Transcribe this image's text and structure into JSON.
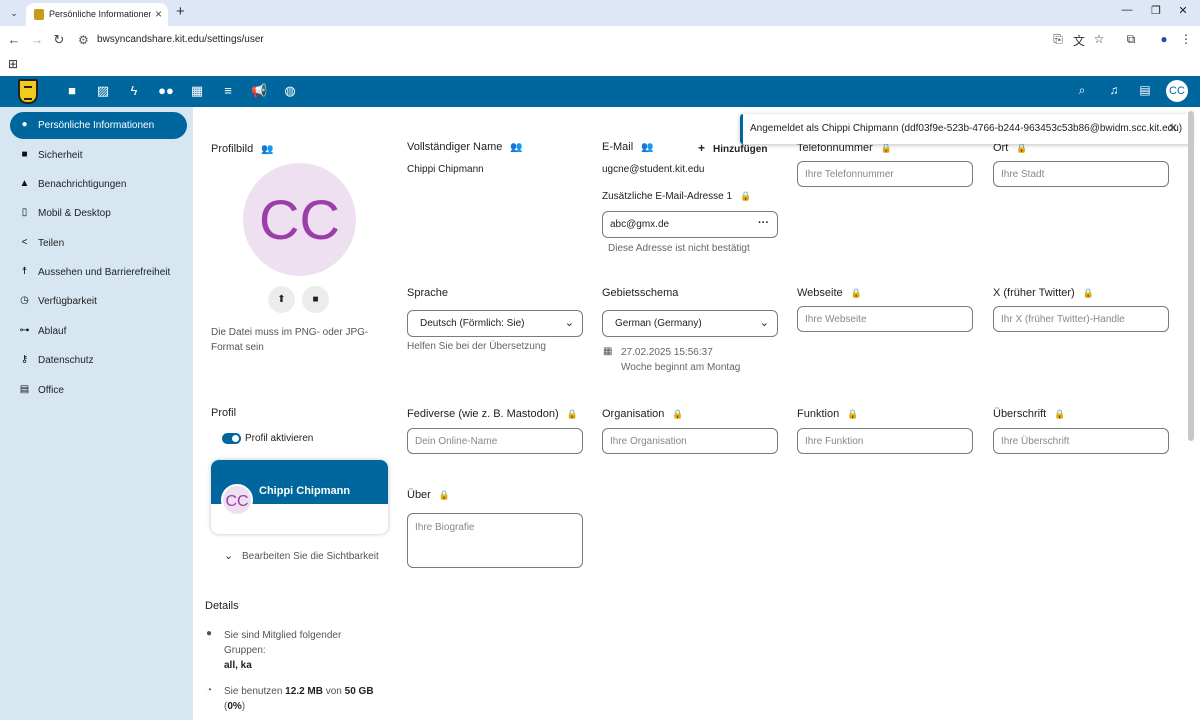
{
  "browser": {
    "tab_title": "Persönliche Informationen - Ein",
    "url": "bwsyncandshare.kit.edu/settings/user"
  },
  "sidebar": {
    "items": [
      {
        "label": "Persönliche Informationen",
        "icon": "person-icon",
        "active": true
      },
      {
        "label": "Sicherheit",
        "icon": "lock-icon"
      },
      {
        "label": "Benachrichtigungen",
        "icon": "bell-icon"
      },
      {
        "label": "Mobil & Desktop",
        "icon": "phone-icon"
      },
      {
        "label": "Teilen",
        "icon": "share-icon"
      },
      {
        "label": "Aussehen und Barrierefreiheit",
        "icon": "accessibility-icon"
      },
      {
        "label": "Verfügbarkeit",
        "icon": "clock-icon"
      },
      {
        "label": "Ablauf",
        "icon": "flow-icon"
      },
      {
        "label": "Datenschutz",
        "icon": "key-icon"
      },
      {
        "label": "Office",
        "icon": "document-icon"
      }
    ]
  },
  "header": {
    "avatar_initials": "CC"
  },
  "toast": {
    "text": "Angemeldet als Chippi Chipmann (ddf03f9e-523b-4766-b244-963453c53b86@bwidm.scc.kit.edu)"
  },
  "profile_picture": {
    "label": "Profilbild",
    "initials": "CC",
    "hint": "Die Datei muss im PNG- oder JPG-Format sein"
  },
  "full_name": {
    "label": "Vollständiger Name",
    "value": "Chippi Chipmann"
  },
  "email": {
    "label": "E-Mail",
    "add_label": "Hinzufügen",
    "value": "ugcne@student.kit.edu",
    "extra_label": "Zusätzliche E-Mail-Adresse 1",
    "extra_value": "abc@gmx.de",
    "extra_hint": "Diese Adresse ist nicht bestätigt"
  },
  "phone": {
    "label": "Telefonnummer",
    "placeholder": "Ihre Telefonnummer"
  },
  "city": {
    "label": "Ort",
    "placeholder": "Ihre Stadt"
  },
  "language": {
    "label": "Sprache",
    "value": "Deutsch (Förmlich: Sie)",
    "hint": "Helfen Sie bei der Übersetzung"
  },
  "locale": {
    "label": "Gebietsschema",
    "value": "German (Germany)",
    "time": "27.02.2025 15:56:37",
    "week_hint": "Woche beginnt am Montag"
  },
  "website": {
    "label": "Webseite",
    "placeholder": "Ihre Webseite"
  },
  "twitter": {
    "label": "X (früher Twitter)",
    "placeholder": "Ihr X (früher Twitter)-Handle"
  },
  "fediverse": {
    "label": "Fediverse (wie z. B. Mastodon)",
    "placeholder": "Dein Online-Name"
  },
  "organisation": {
    "label": "Organisation",
    "placeholder": "Ihre Organisation"
  },
  "role": {
    "label": "Funktion",
    "placeholder": "Ihre Funktion"
  },
  "headline": {
    "label": "Überschrift",
    "placeholder": "Ihre Überschrift"
  },
  "profile": {
    "label": "Profil",
    "toggle_label": "Profil aktivieren",
    "card_name": "Chippi Chipmann",
    "card_initials": "CC",
    "visibility_label": "Bearbeiten Sie die Sichtbarkeit"
  },
  "about": {
    "label": "Über",
    "placeholder": "Ihre Biografie"
  },
  "details": {
    "label": "Details",
    "groups_text": "Sie sind Mitglied folgender Gruppen:",
    "groups_value": "all, ka",
    "usage_prefix": "Sie benutzen",
    "usage_used": "12.2 MB",
    "usage_mid": "von",
    "usage_total": "50 GB",
    "usage_percent": "0%"
  }
}
